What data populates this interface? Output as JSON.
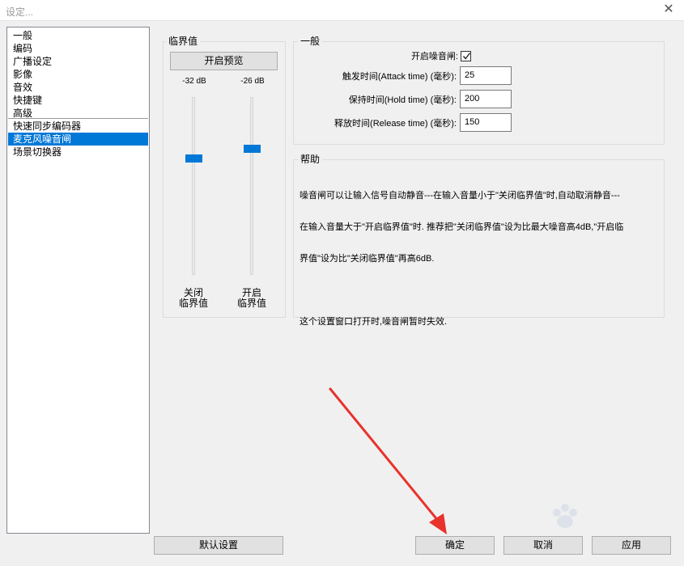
{
  "window": {
    "title": "设定...",
    "close_glyph": "✕"
  },
  "sidebar": {
    "items": [
      {
        "label": "一般"
      },
      {
        "label": "编码"
      },
      {
        "label": "广播设定"
      },
      {
        "label": "影像"
      },
      {
        "label": "音效"
      },
      {
        "label": "快捷键"
      },
      {
        "label": "高级"
      },
      {
        "label": "快速同步编码器"
      },
      {
        "label": "麦克风噪音闸",
        "selected": true
      },
      {
        "label": "场景切换器"
      }
    ]
  },
  "threshold": {
    "group_title": "临界值",
    "preview_button": "开启预览",
    "close_slider": {
      "value_label": "-32 dB",
      "label_line1": "关闭",
      "label_line2": "临界值",
      "level": 0.34
    },
    "open_slider": {
      "value_label": "-26 dB",
      "label_line1": "开启",
      "label_line2": "临界值",
      "level": 0.28
    }
  },
  "general": {
    "group_title": "一般",
    "enable_label": "开启噪音闸:",
    "enable_checked": true,
    "attack_label": "触发时间(Attack time) (毫秒):",
    "attack_value": "25",
    "hold_label": "保持时间(Hold time) (毫秒):",
    "hold_value": "200",
    "release_label": "释放时间(Release time) (毫秒):",
    "release_value": "150"
  },
  "help": {
    "group_title": "帮助",
    "line1": "噪音闸可以让输入信号自动静音---在输入音量小于\"关闭临界值\"时,自动取消静音---",
    "line2": "在输入音量大于\"开启临界值\"时. 推荐把\"关闭临界值\"设为比最大噪音高4dB,\"开启临",
    "line3": "界值\"设为比\"关闭临界值\"再高6dB.",
    "line4": "这个设置窗口打开时,噪音闸暂时失效."
  },
  "footer": {
    "default_button": "默认设置",
    "ok_button": "确定",
    "cancel_button": "取消",
    "apply_button": "应用"
  },
  "colors": {
    "selection": "#0078d7",
    "annotation_arrow": "#e8322c"
  }
}
